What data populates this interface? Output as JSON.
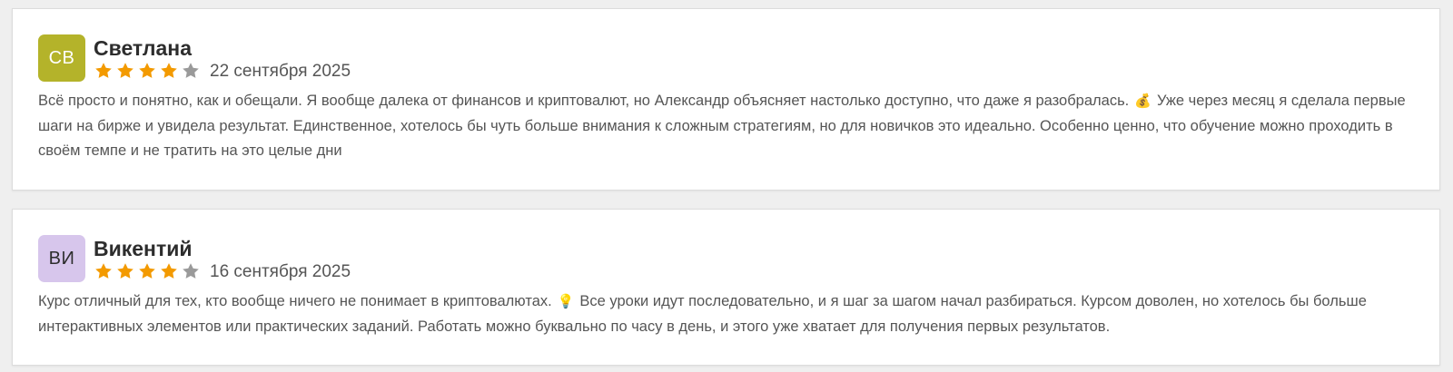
{
  "reviews": [
    {
      "initials": "СВ",
      "avatar_bg": "#b4b32a",
      "avatar_fg": "#ffffff",
      "name": "Светлана",
      "rating": 4,
      "max_rating": 5,
      "date": "22 сентября 2025",
      "text_part1": "Всё просто и понятно, как и обещали. Я вообще далека от финансов и криптовалют, но Александр объясняет настолько доступно, что даже я разобралась.",
      "emoji_icon": "money-bag-icon",
      "emoji": "💰",
      "text_part2": "Уже через месяц я сделала первые шаги на бирже и увидела результат. Единственное, хотелось бы чуть больше внимания к сложным стратегиям, но для новичков это идеально. Особенно ценно, что обучение можно проходить в своём темпе и не тратить на это целые дни"
    },
    {
      "initials": "ВИ",
      "avatar_bg": "#d7c6ec",
      "avatar_fg": "#2d2d2d",
      "name": "Викентий",
      "rating": 4,
      "max_rating": 5,
      "date": "16 сентября 2025",
      "text_part1": "Курс отличный для тех, кто вообще ничего не понимает в криптовалютах.",
      "emoji_icon": "light-bulb-icon",
      "emoji": "💡",
      "text_part2": "Все уроки идут последовательно, и я шаг за шагом начал разбираться. Курсом доволен, но хотелось бы больше интерактивных элементов или практических заданий. Работать можно буквально по часу в день, и этого уже хватает для получения первых результатов."
    }
  ],
  "colors": {
    "star_filled": "#f39a00",
    "star_empty": "#9a9a9a"
  }
}
